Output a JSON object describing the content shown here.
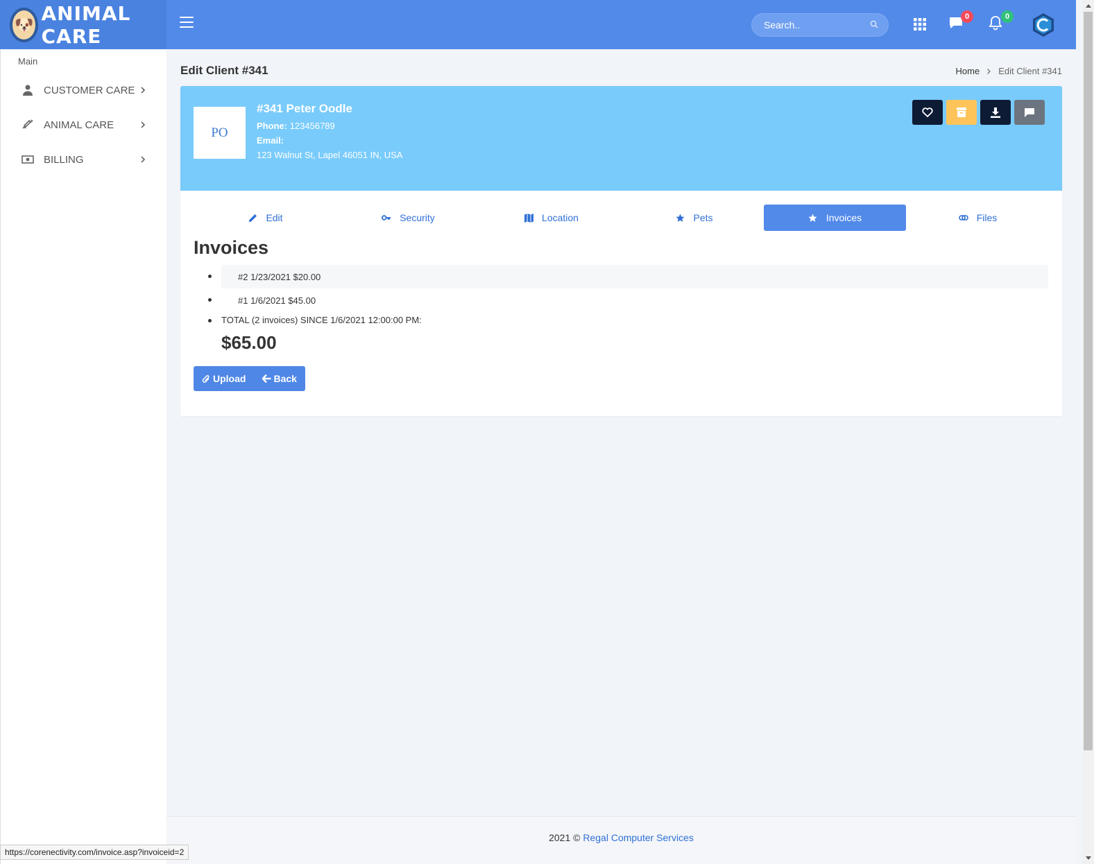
{
  "app": {
    "brand": "ANIMAL CARE"
  },
  "topbar": {
    "search_placeholder": "Search..",
    "messages_count": "0",
    "notifications_count": "0"
  },
  "sidebar": {
    "section": "Main",
    "items": [
      {
        "label": "CUSTOMER CARE",
        "icon": "user-icon"
      },
      {
        "label": "ANIMAL CARE",
        "icon": "syringe-icon"
      },
      {
        "label": "BILLING",
        "icon": "money-icon"
      }
    ]
  },
  "page": {
    "title": "Edit Client #341",
    "breadcrumb": {
      "home": "Home",
      "current": "Edit Client #341"
    }
  },
  "client": {
    "initials": "PO",
    "name": "#341 Peter Oodle",
    "phone_label": "Phone:",
    "phone": "123456789",
    "email_label": "Email:",
    "email": "",
    "address": "123 Walnut St, Lapel 46051 IN, USA"
  },
  "tabs": [
    {
      "label": "Edit",
      "icon": "pencil-icon"
    },
    {
      "label": "Security",
      "icon": "key-icon"
    },
    {
      "label": "Location",
      "icon": "map-icon"
    },
    {
      "label": "Pets",
      "icon": "star-icon"
    },
    {
      "label": "Invoices",
      "icon": "star-icon",
      "active": true
    },
    {
      "label": "Files",
      "icon": "link-icon"
    }
  ],
  "invoices": {
    "heading": "Invoices",
    "items": [
      {
        "text": "#2 1/23/2021 $20.00"
      },
      {
        "text": "#1 1/6/2021 $45.00"
      }
    ],
    "total_label": "TOTAL (2 invoices) SINCE 1/6/2021 12:00:00 PM:",
    "total_amount": "$65.00"
  },
  "buttons": {
    "upload": "Upload",
    "back": "Back"
  },
  "footer": {
    "prefix": "2021 ©",
    "company": "Regal Computer Services"
  },
  "status_url": "https://corenectivity.com/invoice.asp?invoiceid=2",
  "colors": {
    "topbar": "#528ae9",
    "profile_banner": "#79cbfb",
    "accent": "#528ae9",
    "badge_messages": "#f44b5c",
    "badge_notifications": "#2fc17a"
  }
}
